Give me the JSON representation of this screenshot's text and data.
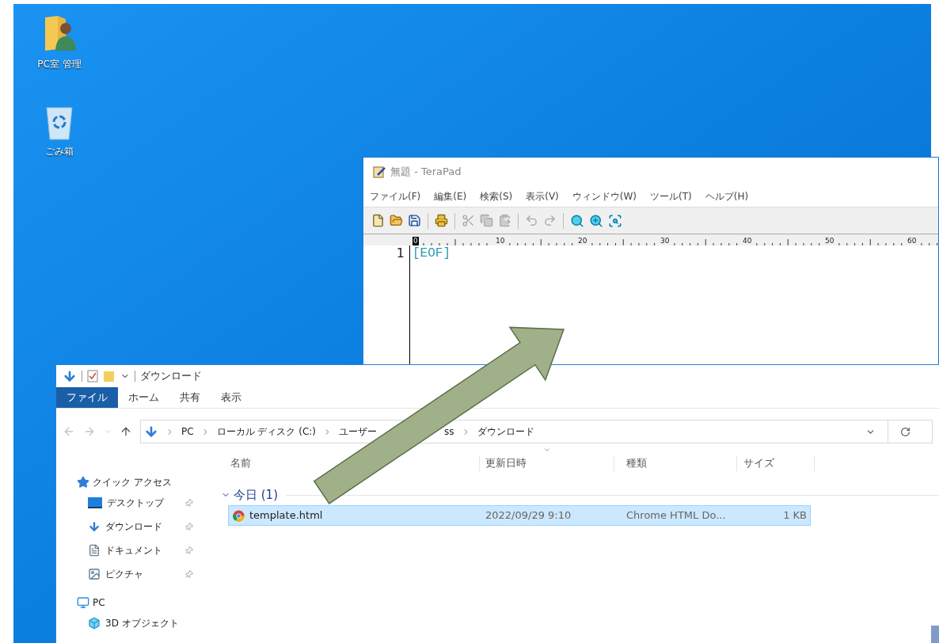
{
  "desktop": {
    "icons": [
      {
        "label": "PC室 管理",
        "kind": "user-folder"
      },
      {
        "label": "ごみ箱",
        "kind": "recycle-bin"
      }
    ]
  },
  "editor": {
    "title": "無題 - TeraPad",
    "menu": [
      "ファイル(F)",
      "編集(E)",
      "検索(S)",
      "表示(V)",
      "ウィンドウ(W)",
      "ツール(T)",
      "ヘルプ(H)"
    ],
    "ruler": [
      "0",
      "10",
      "20",
      "30",
      "40",
      "50",
      "60"
    ],
    "lines": [
      {
        "number": "1",
        "text": "[EOF]"
      }
    ]
  },
  "explorer": {
    "title": "ダウンロード",
    "ribbon_tabs": [
      {
        "label": "ファイル",
        "selected": true
      },
      {
        "label": "ホーム",
        "selected": false
      },
      {
        "label": "共有",
        "selected": false
      },
      {
        "label": "表示",
        "selected": false
      }
    ],
    "breadcrumb": [
      "PC",
      "ローカル ディスク (C:)",
      "ユーザー"
    ],
    "breadcrumb_covered_tail": "ss",
    "breadcrumb_current": "ダウンロード",
    "sidebar": [
      {
        "label": "クイック アクセス",
        "kind": "star",
        "children": [
          {
            "label": "デスクトップ",
            "kind": "desktop",
            "pinned": true
          },
          {
            "label": "ダウンロード",
            "kind": "download",
            "pinned": true
          },
          {
            "label": "ドキュメント",
            "kind": "document",
            "pinned": true
          },
          {
            "label": "ピクチャ",
            "kind": "pictures",
            "pinned": true
          }
        ]
      },
      {
        "label": "PC",
        "kind": "pc",
        "children": [
          {
            "label": "3D オブジェクト",
            "kind": "cube",
            "pinned": false
          }
        ]
      }
    ],
    "columns": [
      "名前",
      "更新日時",
      "種類",
      "サイズ"
    ],
    "groups": [
      {
        "label": "今日 (1)",
        "expanded": true,
        "files": [
          {
            "name": "template.html",
            "modified": "2022/09/29 9:10",
            "type": "Chrome HTML Do...",
            "size": "1 KB",
            "selected": true
          }
        ]
      }
    ]
  }
}
